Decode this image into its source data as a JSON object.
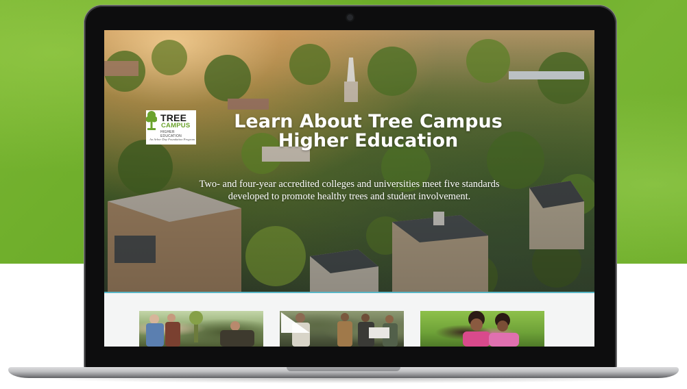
{
  "hero": {
    "title_line1": "Learn About Tree Campus",
    "title_line2": "Higher Education",
    "subtitle_line1": "Two- and four-year accredited colleges and universities meet five standards",
    "subtitle_line2": "developed to promote healthy trees and student involvement."
  },
  "logo": {
    "line1": "TREE",
    "line2": "CAMPUS",
    "line3": "HIGHER EDUCATION",
    "line4": "An Arbor Day Foundation Program",
    "icon": "tree-icon"
  },
  "cards": [
    {
      "image": "students-planting-photo"
    },
    {
      "image": "group-planting-video",
      "icon": "play-icon"
    },
    {
      "image": "students-smiling-photo"
    }
  ],
  "colors": {
    "background_green": "#6fae2b",
    "logo_green": "#6aa22c",
    "divider": "#58b6c6"
  }
}
